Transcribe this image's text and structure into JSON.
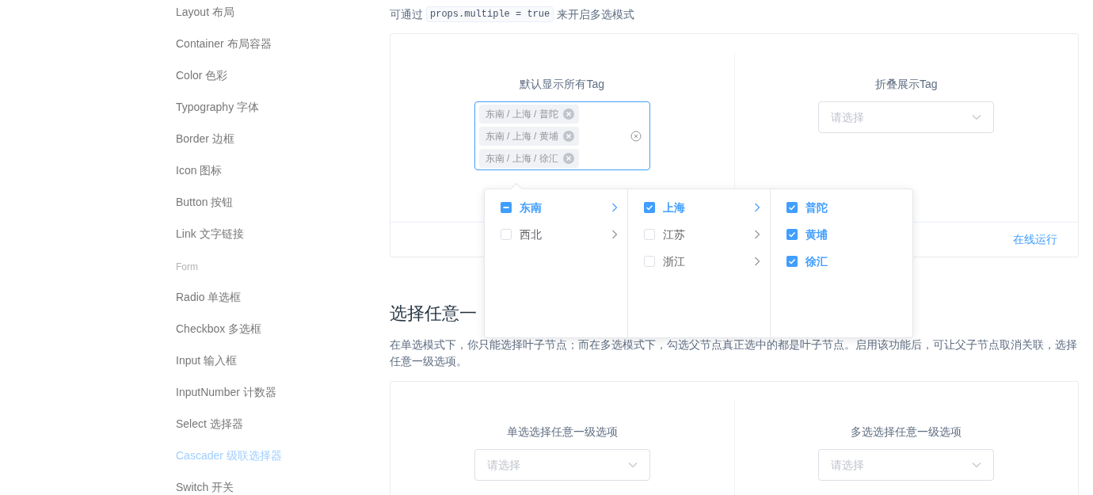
{
  "sidebar": {
    "items": [
      {
        "kind": "item",
        "label": "Layout 布局",
        "selected": false
      },
      {
        "kind": "item",
        "label": "Container 布局容器",
        "selected": false
      },
      {
        "kind": "item",
        "label": "Color 色彩",
        "selected": false
      },
      {
        "kind": "item",
        "label": "Typography 字体",
        "selected": false
      },
      {
        "kind": "item",
        "label": "Border 边框",
        "selected": false
      },
      {
        "kind": "item",
        "label": "Icon 图标",
        "selected": false
      },
      {
        "kind": "item",
        "label": "Button 按钮",
        "selected": false
      },
      {
        "kind": "item",
        "label": "Link 文字链接",
        "selected": false
      },
      {
        "kind": "group",
        "label": "Form"
      },
      {
        "kind": "item",
        "label": "Radio 单选框",
        "selected": false
      },
      {
        "kind": "item",
        "label": "Checkbox 多选框",
        "selected": false
      },
      {
        "kind": "item",
        "label": "Input 输入框",
        "selected": false
      },
      {
        "kind": "item",
        "label": "InputNumber 计数器",
        "selected": false
      },
      {
        "kind": "item",
        "label": "Select 选择器",
        "selected": false
      },
      {
        "kind": "item",
        "label": "Cascader 级联选择器",
        "selected": true
      },
      {
        "kind": "item",
        "label": "Switch 开关",
        "selected": false
      }
    ]
  },
  "intro": {
    "before": "可通过",
    "code": "props.multiple = true",
    "after": "来开启多选模式"
  },
  "demo_1": {
    "columns": [
      {
        "title": "默认显示所有Tag",
        "tags": [
          "东南 / 上海 / 普陀",
          "东南 / 上海 / 黄埔",
          "东南 / 上海 / 徐汇"
        ],
        "focused": true
      },
      {
        "title": "折叠展示Tag",
        "placeholder": "请选择",
        "focused": false
      }
    ],
    "footer_link": "在线运行"
  },
  "cascader_menu": {
    "columns": [
      {
        "options": [
          {
            "label": "东南",
            "checked": false,
            "indeterminate": true,
            "expanded": true,
            "kind": "branch"
          },
          {
            "label": "西北",
            "checked": false,
            "indeterminate": false,
            "expanded": false,
            "kind": "branch"
          }
        ]
      },
      {
        "options": [
          {
            "label": "上海",
            "checked": true,
            "indeterminate": false,
            "expanded": true,
            "kind": "branch"
          },
          {
            "label": "江苏",
            "checked": false,
            "indeterminate": false,
            "expanded": false,
            "kind": "branch"
          },
          {
            "label": "浙江",
            "checked": false,
            "indeterminate": false,
            "expanded": false,
            "kind": "branch"
          }
        ]
      },
      {
        "options": [
          {
            "label": "普陀",
            "checked": true,
            "indeterminate": false,
            "kind": "leaf"
          },
          {
            "label": "黄埔",
            "checked": true,
            "indeterminate": false,
            "kind": "leaf"
          },
          {
            "label": "徐汇",
            "checked": true,
            "indeterminate": false,
            "kind": "leaf"
          }
        ]
      }
    ]
  },
  "section_2": {
    "heading": "选择任意一",
    "paragraph": "在单选模式下，你只能选择叶子节点；而在多选模式下，勾选父节点真正选中的都是叶子节点。启用该功能后，可让父子节点取消关联，选择任意一级选项。",
    "columns": [
      {
        "title": "单选选择任意一级选项",
        "placeholder": "请选择"
      },
      {
        "title": "多选选择任意一级选项",
        "placeholder": "请选择"
      }
    ]
  }
}
